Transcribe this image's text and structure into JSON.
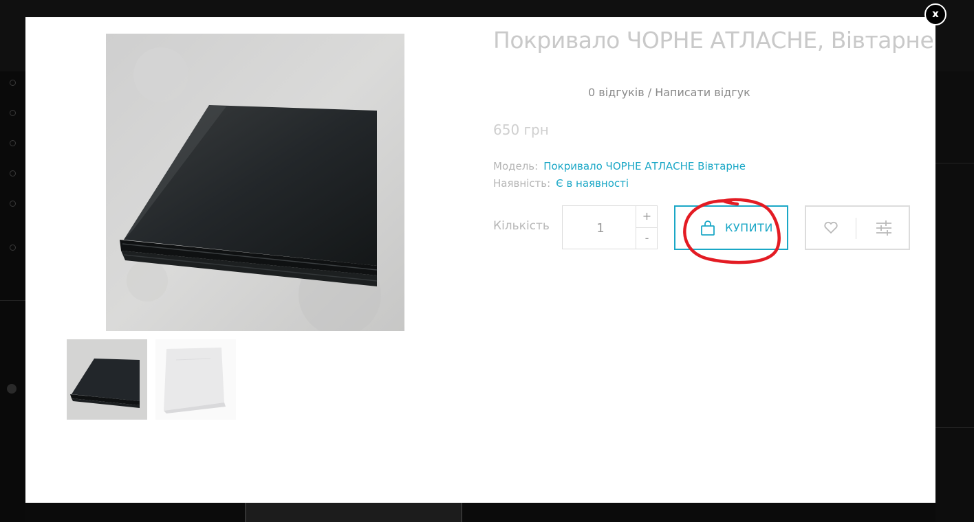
{
  "product": {
    "title": "Покривало ЧОРНЕ АТЛАСНЕ, Вівтарне",
    "reviews_count": "0 відгуків",
    "reviews_separator": " / ",
    "write_review": "Написати відгук",
    "price": "650 грн",
    "model_label": "Модель:",
    "model_value": "Покривало ЧОРНЕ АТЛАСНЕ Вівтарне",
    "availability_label": "Наявність:",
    "availability_value": "Є в наявності",
    "quantity_label": "Кількість",
    "quantity_value": "1",
    "qty_plus": "+",
    "qty_minus": "-",
    "buy_label": "КУПИТИ"
  },
  "close_label": "x",
  "colors": {
    "accent": "#1aa7c6",
    "annotation": "#e31b23"
  },
  "icons": [
    "close-icon",
    "bag-icon",
    "heart-icon",
    "compare-icon"
  ]
}
